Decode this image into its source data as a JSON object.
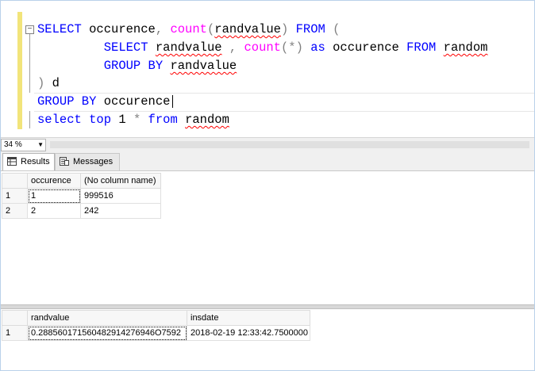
{
  "editor": {
    "line1": {
      "select": "SELECT",
      "occurence": " occurence",
      "comma": ",",
      "count": " count",
      "paren_open": "(",
      "randvalue": "randvalue",
      "paren_close": ")",
      "from": " FROM",
      "open": " ("
    },
    "line2": {
      "select": "SELECT",
      "randvalue": "randvalue",
      "comma": " ,",
      "count": " count",
      "star": "(*)",
      "as": " as",
      "occurence": " occurence",
      "from": " FROM",
      "random": "random"
    },
    "line3": {
      "group": "GROUP BY",
      "randvalue": "randvalue"
    },
    "line4": {
      "close": ")",
      "alias": " d"
    },
    "line5": {
      "group": "GROUP BY",
      "occurence": " occurence"
    },
    "line6": {
      "select": "select",
      "top": " top",
      "num": " 1",
      "star": " *",
      "from": " from",
      "random": "random"
    },
    "outline_symbol": "−"
  },
  "zoom": {
    "value": "34 %",
    "arrow": "▼"
  },
  "tabs": [
    {
      "label": "Results"
    },
    {
      "label": "Messages"
    }
  ],
  "grid1": {
    "columns": [
      "occurence",
      "(No column name)"
    ],
    "rows": [
      {
        "num": "1",
        "occurence": "1",
        "value": "999516"
      },
      {
        "num": "2",
        "occurence": "2",
        "value": "242"
      }
    ]
  },
  "grid2": {
    "columns": [
      "randvalue",
      "insdate"
    ],
    "rows": [
      {
        "num": "1",
        "randvalue": "0.288560171560482914276946O7592",
        "insdate": "2018-02-19 12:33:42.7500000"
      }
    ]
  }
}
